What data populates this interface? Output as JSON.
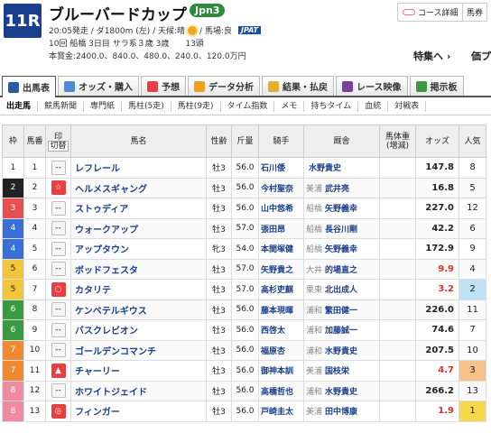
{
  "race": {
    "number": "11R",
    "name": "ブルーバードカップ",
    "grade": "Jpn3",
    "info1": "20:05発走 / ダ1800m (左) / 天候:晴",
    "going": "/ 馬場:良",
    "jpat": "JPAT",
    "info2": "10回 船橋 3日目 サラ系３歳 3歳　　13頭",
    "prize": "本賞金:2400.0、840.0、480.0、240.0、120.0万円"
  },
  "header_links": {
    "course": "コース詳細",
    "bashu": "馬券",
    "special": "特集へ ›",
    "kaiko": "価プ"
  },
  "tabs": [
    {
      "label": "出馬表",
      "icon": "table-icon",
      "color": "#2c5aa0"
    },
    {
      "label": "オッズ・購入",
      "icon": "odds-icon",
      "color": "#4a8ad8"
    },
    {
      "label": "予想",
      "icon": "target-icon",
      "color": "#e84040"
    },
    {
      "label": "データ分析",
      "icon": "chart-icon",
      "color": "#f0a020"
    },
    {
      "label": "結果・払戻",
      "icon": "coin-icon",
      "color": "#e0b030"
    },
    {
      "label": "レース映像",
      "icon": "video-icon",
      "color": "#7a3fa0"
    },
    {
      "label": "掲示板",
      "icon": "board-icon",
      "color": "#3a9a40"
    }
  ],
  "subtabs": [
    "出走馬",
    "競馬新聞",
    "専門紙",
    "馬柱(5走)",
    "馬柱(9走)",
    "タイム指数",
    "メモ",
    "持ちタイム",
    "血統",
    "対戦表"
  ],
  "columns": {
    "waku": "枠",
    "umaban": "馬番",
    "mark": "印",
    "mark2": "切替",
    "horse": "馬名",
    "sex": "性齢",
    "kin": "斤量",
    "jockey": "騎手",
    "trainer": "厩舎",
    "weight": "馬体重",
    "weight2": "(増減)",
    "odds": "オッズ",
    "pop": "人気",
    "ninki2": "馬券"
  },
  "waku_colors": {
    "1": "#ffffff",
    "2": "#222222",
    "3": "#e85050",
    "4": "#3a6fd8",
    "5": "#f2c63a",
    "6": "#3a9a40",
    "7": "#f08a30",
    "8": "#f08aa0"
  },
  "rows": [
    {
      "waku": "1",
      "umaban": "1",
      "mark": "--",
      "mark_type": "",
      "horse": "レフレール",
      "sex": "牡3",
      "kin": "56.0",
      "jockey": "石川倭",
      "loc": "",
      "trainer": "水野貴史",
      "odds": "147.8",
      "red": false,
      "pop": "8"
    },
    {
      "waku": "2",
      "umaban": "2",
      "mark": "☆",
      "mark_type": "star",
      "horse": "ヘルメスギャング",
      "sex": "牡3",
      "kin": "56.0",
      "jockey": "今村聖奈",
      "loc": "美浦",
      "trainer": "武井亮",
      "odds": "16.8",
      "red": false,
      "pop": "5"
    },
    {
      "waku": "3",
      "umaban": "3",
      "mark": "--",
      "mark_type": "",
      "horse": "ストゥディア",
      "sex": "牡3",
      "kin": "56.0",
      "jockey": "山中悠希",
      "loc": "船橋",
      "trainer": "矢野義幸",
      "odds": "227.0",
      "red": false,
      "pop": "12"
    },
    {
      "waku": "4",
      "umaban": "4",
      "mark": "--",
      "mark_type": "",
      "horse": "ウォークアップ",
      "sex": "牡3",
      "kin": "57.0",
      "jockey": "張田昂",
      "loc": "船橋",
      "trainer": "長谷川剛",
      "odds": "42.2",
      "red": false,
      "pop": "6"
    },
    {
      "waku": "4",
      "umaban": "5",
      "mark": "--",
      "mark_type": "",
      "horse": "アップタウン",
      "sex": "牝3",
      "kin": "54.0",
      "jockey": "本間塚健",
      "loc": "船橋",
      "trainer": "矢野義幸",
      "odds": "172.9",
      "red": false,
      "pop": "9"
    },
    {
      "waku": "5",
      "umaban": "6",
      "mark": "--",
      "mark_type": "",
      "horse": "ボッドフェスタ",
      "sex": "牡3",
      "kin": "57.0",
      "jockey": "矢野貴之",
      "loc": "大井",
      "trainer": "的場直之",
      "odds": "9.9",
      "red": true,
      "pop": "4"
    },
    {
      "waku": "5",
      "umaban": "7",
      "mark": "○",
      "mark_type": "circle",
      "horse": "カタリテ",
      "sex": "牡3",
      "kin": "57.0",
      "jockey": "高杉吏麒",
      "loc": "栗東",
      "trainer": "北出成人",
      "odds": "3.2",
      "red": true,
      "pop": "2"
    },
    {
      "waku": "6",
      "umaban": "8",
      "mark": "--",
      "mark_type": "",
      "horse": "ケンベテルギウス",
      "sex": "牡3",
      "kin": "56.0",
      "jockey": "藤本現暉",
      "loc": "浦和",
      "trainer": "繁田健一",
      "odds": "226.0",
      "red": false,
      "pop": "11"
    },
    {
      "waku": "6",
      "umaban": "9",
      "mark": "--",
      "mark_type": "",
      "horse": "バスクレビオン",
      "sex": "牡3",
      "kin": "56.0",
      "jockey": "西啓太",
      "loc": "浦和",
      "trainer": "加藤誠一",
      "odds": "74.6",
      "red": false,
      "pop": "7"
    },
    {
      "waku": "7",
      "umaban": "10",
      "mark": "--",
      "mark_type": "",
      "horse": "ゴールデンコマンチ",
      "sex": "牡3",
      "kin": "56.0",
      "jockey": "福原杏",
      "loc": "浦和",
      "trainer": "水野貴史",
      "odds": "207.5",
      "red": false,
      "pop": "10"
    },
    {
      "waku": "7",
      "umaban": "11",
      "mark": "▲",
      "mark_type": "tri",
      "horse": "チャーリー",
      "sex": "牡3",
      "kin": "56.0",
      "jockey": "御神本訓",
      "loc": "美浦",
      "trainer": "国枝栄",
      "odds": "4.7",
      "red": true,
      "pop": "3"
    },
    {
      "waku": "8",
      "umaban": "12",
      "mark": "--",
      "mark_type": "",
      "horse": "ホワイトジェイド",
      "sex": "牡3",
      "kin": "56.0",
      "jockey": "高橋哲也",
      "loc": "浦和",
      "trainer": "水野貴史",
      "odds": "266.2",
      "red": false,
      "pop": "13"
    },
    {
      "waku": "8",
      "umaban": "13",
      "mark": "◎",
      "mark_type": "ana",
      "horse": "フィンガー",
      "sex": "牡3",
      "kin": "56.0",
      "jockey": "戸崎圭太",
      "loc": "美浦",
      "trainer": "田中博康",
      "odds": "1.9",
      "red": true,
      "pop": "1"
    }
  ],
  "pop_colors": {
    "1": "#f5d94a",
    "2": "#bfe0f5",
    "3": "#f5c08a"
  }
}
